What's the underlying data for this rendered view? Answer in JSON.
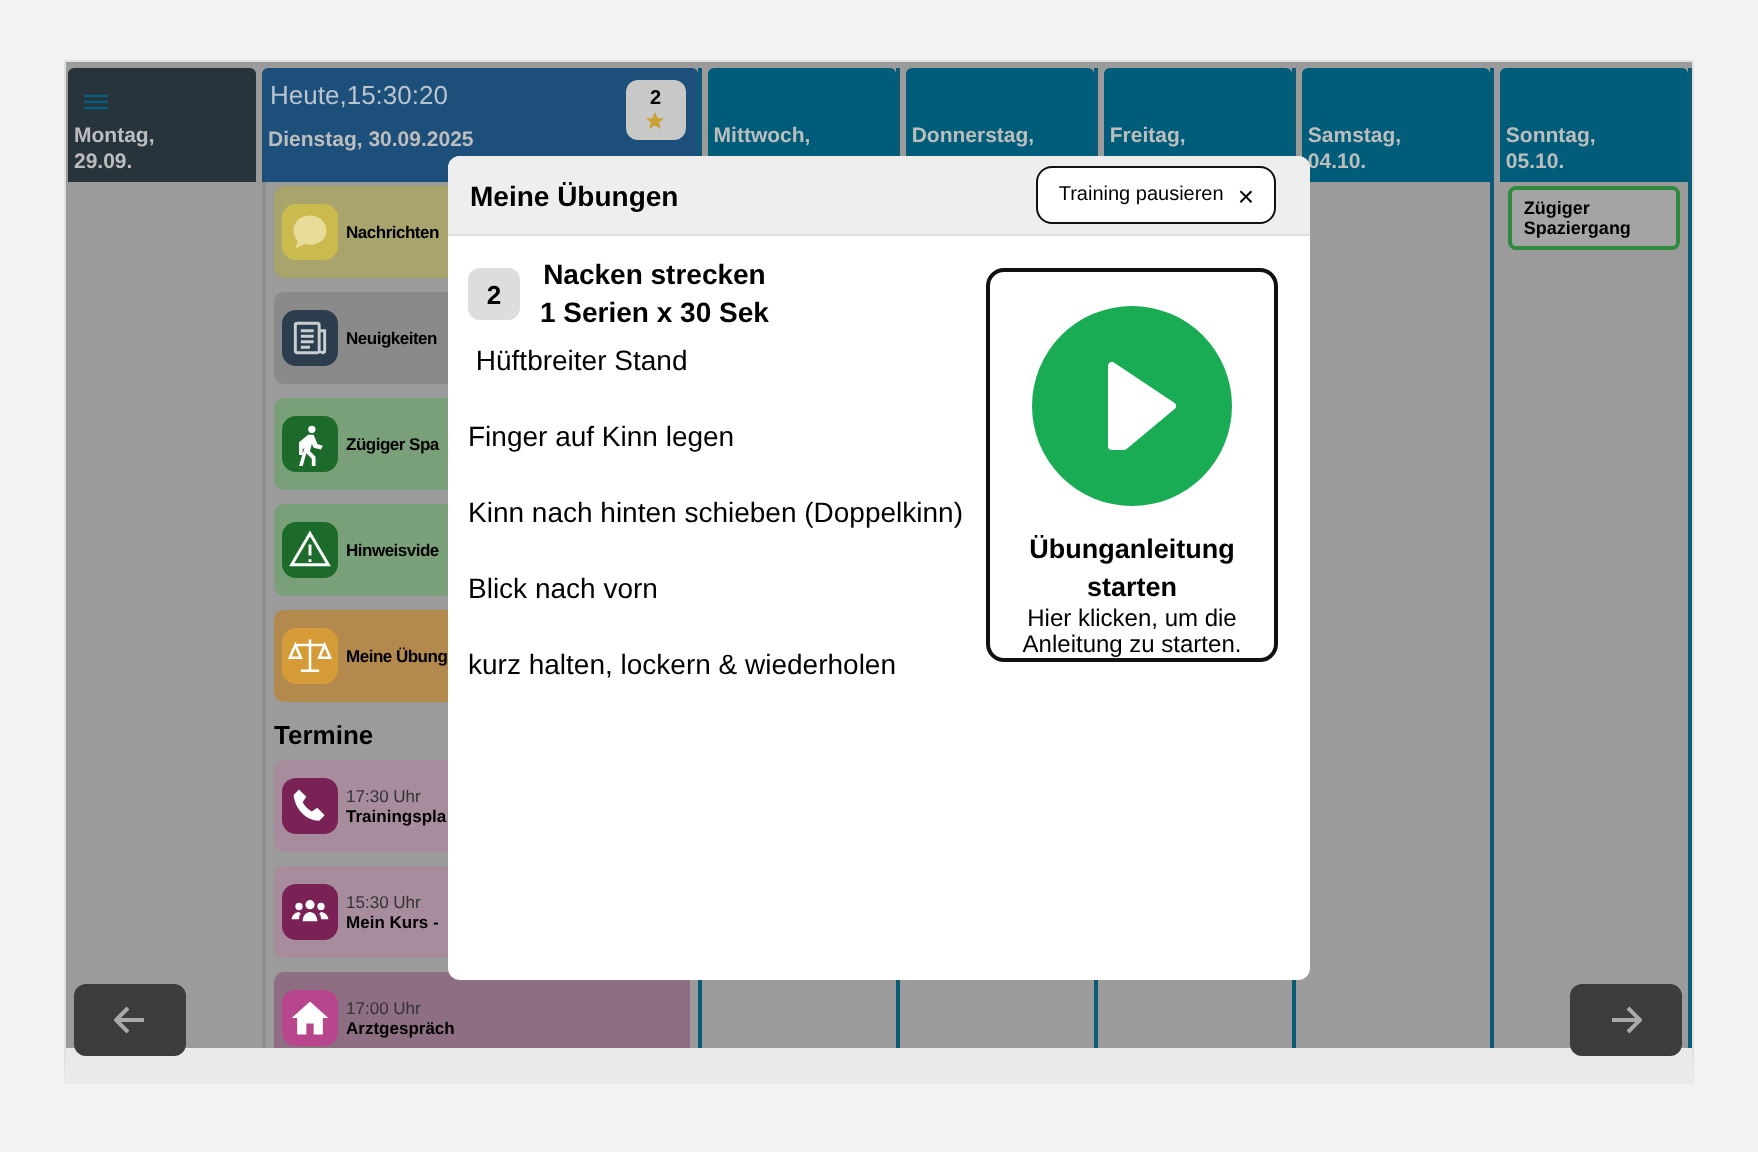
{
  "days": [
    {
      "kind": "past",
      "lines": [
        "Montag,",
        "29.09."
      ],
      "menu": true
    },
    {
      "kind": "today",
      "lines": [
        "Heute,15:30:20",
        "Dienstag, 30.09.2025"
      ],
      "badge": "2",
      "tiles": [
        {
          "kind": "message",
          "label": "Nachrichten"
        },
        {
          "kind": "news",
          "label": "Neuigkeiten"
        },
        {
          "kind": "walk",
          "label": "Zügiger Spa"
        },
        {
          "kind": "warning",
          "label": "Hinweisvide"
        },
        {
          "kind": "exercises",
          "label": "Meine Übung"
        }
      ],
      "appointments_heading": "Termine",
      "appointments": [
        {
          "kind": "phone",
          "time": "17:30 Uhr",
          "title": "Trainingspla"
        },
        {
          "kind": "group",
          "time": "15:30 Uhr",
          "title": "Mein Kurs - "
        },
        {
          "kind": "home",
          "time": "17:00 Uhr",
          "title": "Arztgespräch"
        }
      ]
    },
    {
      "kind": "future",
      "lines": [
        "Mittwoch,"
      ]
    },
    {
      "kind": "future",
      "lines": [
        "Donnerstag,"
      ]
    },
    {
      "kind": "future",
      "lines": [
        "Freitag,"
      ]
    },
    {
      "kind": "future",
      "lines": [
        "Samstag,",
        "04.10."
      ]
    },
    {
      "kind": "future",
      "lines": [
        "Sonntag,",
        "05.10."
      ],
      "entries": [
        "Zügiger Spaziergang"
      ]
    }
  ],
  "modal": {
    "title": "Meine Übungen",
    "pause_button": "Training pausieren",
    "close": "×",
    "number": "2",
    "exercise": "Nacken strecken",
    "dose": "1 Serien  x 30 Sek",
    "steps": [
      " Hüftbreiter Stand",
      "Finger auf Kinn legen",
      "Kinn nach hinten schieben (Doppelkinn)",
      "Blick nach vorn",
      "kurz halten, lockern & wiederholen"
    ],
    "start_card": {
      "title": "Übunganleitung starten",
      "hint": "Hier klicken, um die Anleitung zu starten."
    }
  }
}
